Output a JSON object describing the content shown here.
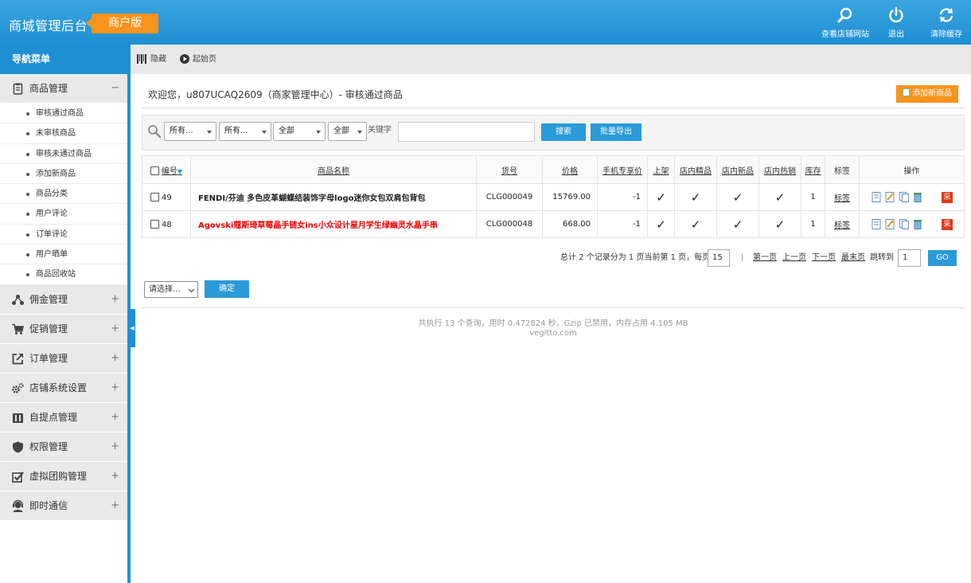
{
  "header": {
    "logo": "商城管理后台",
    "badge": "商户版",
    "buttons": [
      {
        "label": "查看店铺网站",
        "icon": "search-icon"
      },
      {
        "label": "退出",
        "icon": "power-icon"
      },
      {
        "label": "清除缓存",
        "icon": "refresh-icon"
      }
    ]
  },
  "sidebar": {
    "title": "导航菜单",
    "expanded_group": {
      "label": "商品管理",
      "toggle": "−",
      "icon": "clipboard-icon"
    },
    "sub_items": [
      "审核通过商品",
      "未审核商品",
      "审核未通过商品",
      "添加新商品",
      "商品分类",
      "用户评论",
      "订单评论",
      "用户晒单",
      "商品回收站"
    ],
    "groups": [
      {
        "label": "佣金管理",
        "toggle": "+",
        "icon": "share-icon"
      },
      {
        "label": "促销管理",
        "toggle": "+",
        "icon": "cart-icon"
      },
      {
        "label": "订单管理",
        "toggle": "+",
        "icon": "external-link-icon"
      },
      {
        "label": "店铺系统设置",
        "toggle": "+",
        "icon": "gears-icon"
      },
      {
        "label": "自提点管理",
        "toggle": "+",
        "icon": "store-icon"
      },
      {
        "label": "权限管理",
        "toggle": "+",
        "icon": "shield-icon"
      },
      {
        "label": "虚拟团购管理",
        "toggle": "+",
        "icon": "checkbox-icon"
      },
      {
        "label": "即时通信",
        "toggle": "+",
        "icon": "support-icon"
      }
    ]
  },
  "toolbar": {
    "hide": "隐藏",
    "start_page": "起始页"
  },
  "content": {
    "welcome": "欢迎您，u807UCAQ2609（商家管理中心）- 审核通过商品",
    "add_button": "添加新商品"
  },
  "filter": {
    "selects": [
      "所有...",
      "所有...",
      "全部",
      "全部"
    ],
    "keyword_label": "关键字",
    "keyword_value": "",
    "search_button": "搜索",
    "export_button": "批量导出"
  },
  "table": {
    "headers": [
      "编号",
      "商品名称",
      "货号",
      "价格",
      "手机专享价",
      "上架",
      "店内精品",
      "店内新品",
      "店内热销",
      "库存",
      "标签",
      "操作"
    ],
    "rows": [
      {
        "id": "49",
        "name": "FENDI/芬迪 多色皮革蝴蝶结装饰字母logo迷你女包双肩包背包",
        "red": false,
        "sku": "CLG000049",
        "price": "15769.00",
        "mobile_price": "-1",
        "on_sale": "✓",
        "best": "✓",
        "new": "✓",
        "hot": "✓",
        "stock": "1",
        "tag": "标签",
        "cai": "采"
      },
      {
        "id": "48",
        "name": "Agovski蔻斯琦草莓晶手链女ins小众设计星月学生绿幽灵水晶手串",
        "red": true,
        "sku": "CLG000048",
        "price": "668.00",
        "mobile_price": "-1",
        "on_sale": "✓",
        "best": "✓",
        "new": "✓",
        "hot": "✓",
        "stock": "1",
        "tag": "标签",
        "cai": "采"
      }
    ]
  },
  "pager": {
    "summary": "总计 2 个记录分为 1 页当前第 1 页，每页",
    "per_page": "15",
    "separator": "|",
    "first": "第一页",
    "prev": "上一页",
    "next": "下一页",
    "last": "最末页",
    "goto_label": "跳转到",
    "goto_value": "1",
    "go_button": "GO"
  },
  "batch": {
    "select": "请选择...",
    "confirm": "确定"
  },
  "footer": {
    "line1": "共执行 13 个查询，用时 0.472824 秒，Gzip 已禁用，内存占用 4.105 MB",
    "line2": "vegitto.com"
  }
}
